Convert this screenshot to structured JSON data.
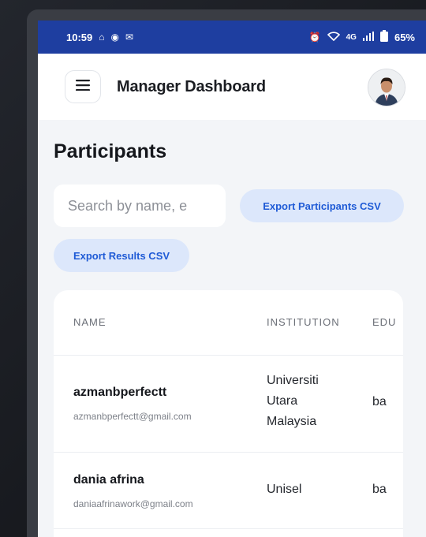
{
  "status_bar": {
    "time": "10:59",
    "left_icons": [
      "home-outline-icon",
      "settings-dot-icon",
      "gmail-icon"
    ],
    "right_icons": [
      "alarm-icon",
      "wifi-icon",
      "signal-4g-icon",
      "battery-icon"
    ],
    "network": "4G",
    "battery": "65%",
    "color": "#1e3ea0"
  },
  "app_bar": {
    "title": "Manager Dashboard",
    "menu_icon": "hamburger-menu-icon",
    "avatar_icon": "user-avatar"
  },
  "page": {
    "title": "Participants"
  },
  "search": {
    "placeholder": "Search by name, e"
  },
  "actions": {
    "export_participants": "Export Participants CSV",
    "export_results": "Export Results CSV",
    "accent": "#1f5bd6"
  },
  "table": {
    "columns": [
      "NAME",
      "INSTITUTION",
      "EDU"
    ],
    "rows": [
      {
        "name": "azmanbperfectt",
        "email": "azmanbperfectt@gmail.com",
        "institution_lines": [
          "Universiti",
          "Utara",
          "Malaysia"
        ],
        "education": "ba"
      },
      {
        "name": "dania afrina",
        "email": "daniaafrinawork@gmail.com",
        "institution_lines": [
          "Unisel"
        ],
        "education": "ba"
      }
    ]
  }
}
